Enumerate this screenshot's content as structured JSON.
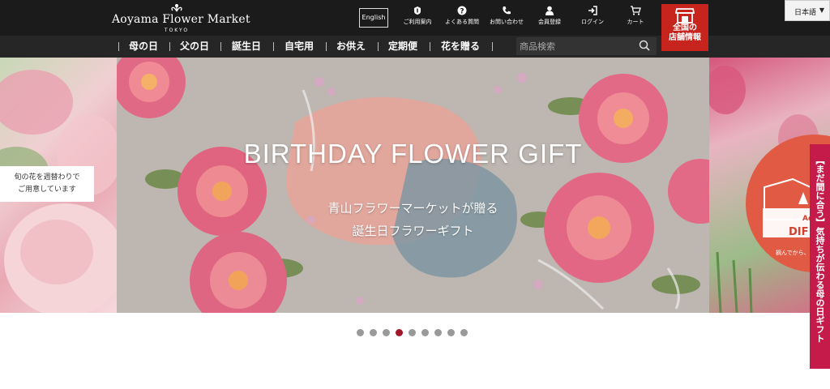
{
  "header": {
    "logo_name": "Aoyama Flower Market",
    "logo_sub": "TOKYO",
    "english_label": "English",
    "icons": [
      {
        "name": "guide-icon",
        "label": "ご利用案内"
      },
      {
        "name": "faq-icon",
        "label": "よくある質問"
      },
      {
        "name": "phone-icon",
        "label": "お問い合わせ"
      },
      {
        "name": "user-icon",
        "label": "会員登録"
      },
      {
        "name": "login-icon",
        "label": "ログイン"
      },
      {
        "name": "cart-icon",
        "label": "カート"
      }
    ],
    "store_line1": "全国の",
    "store_line2": "店舗情報",
    "language": "日本語"
  },
  "categories": [
    "母の日",
    "父の日",
    "誕生日",
    "自宅用",
    "お供え",
    "定期便",
    "花を贈る"
  ],
  "search": {
    "placeholder": "商品検索"
  },
  "hero": {
    "left_caption_line1": "旬の花を週替わりで",
    "left_caption_line2": "ご用意しています",
    "title": "BIRTHDAY FLOWER GIFT",
    "subtitle_line1": "青山フラワーマーケットが贈る",
    "subtitle_line2": "誕生日フラワーギフト",
    "right_partial_1": "Ao",
    "right_partial_2": "DIF",
    "right_partial_3": "摘んでから、ま"
  },
  "side_banner": "【まだ間に合う】気持ちが伝わる母の日ギフト",
  "carousel": {
    "total": 9,
    "active_index": 3
  },
  "colors": {
    "accent_red": "#c8241e",
    "banner_pink": "#c51b4a",
    "header_bg": "#1b1b1b",
    "dot_active": "#a01828"
  }
}
